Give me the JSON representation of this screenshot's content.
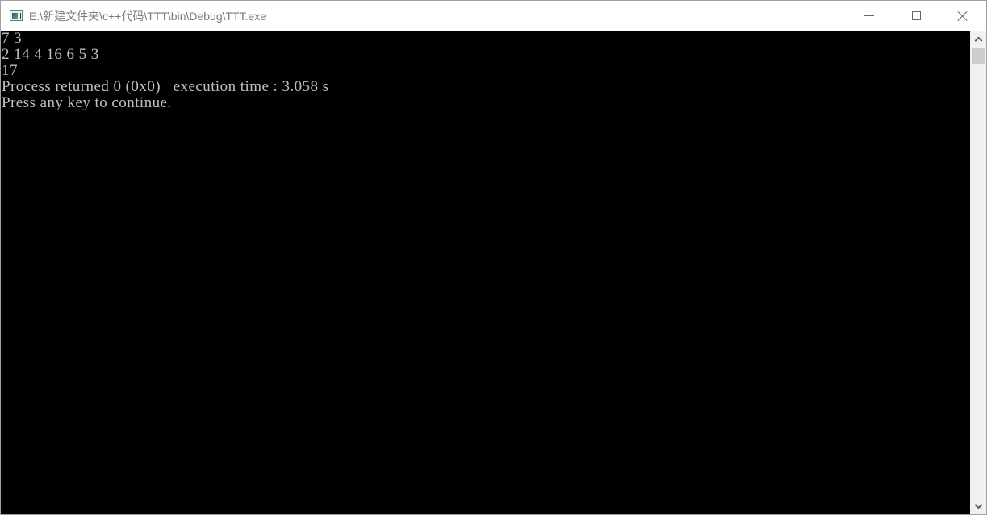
{
  "window": {
    "title": "E:\\新建文件夹\\c++代码\\TTT\\bin\\Debug\\TTT.exe",
    "icon": "console-app-icon",
    "controls": {
      "minimize": "minimize-icon",
      "maximize": "maximize-icon",
      "close": "close-icon"
    }
  },
  "console": {
    "lines": [
      "7 3",
      "2 14 4 16 6 5 3",
      "17",
      "Process returned 0 (0x0)   execution time : 3.058 s",
      "Press any key to continue."
    ],
    "colors": {
      "background": "#000000",
      "foreground": "#c0c0c0"
    }
  },
  "scrollbar": {
    "up_icon": "chevron-up-icon",
    "down_icon": "chevron-down-icon"
  }
}
